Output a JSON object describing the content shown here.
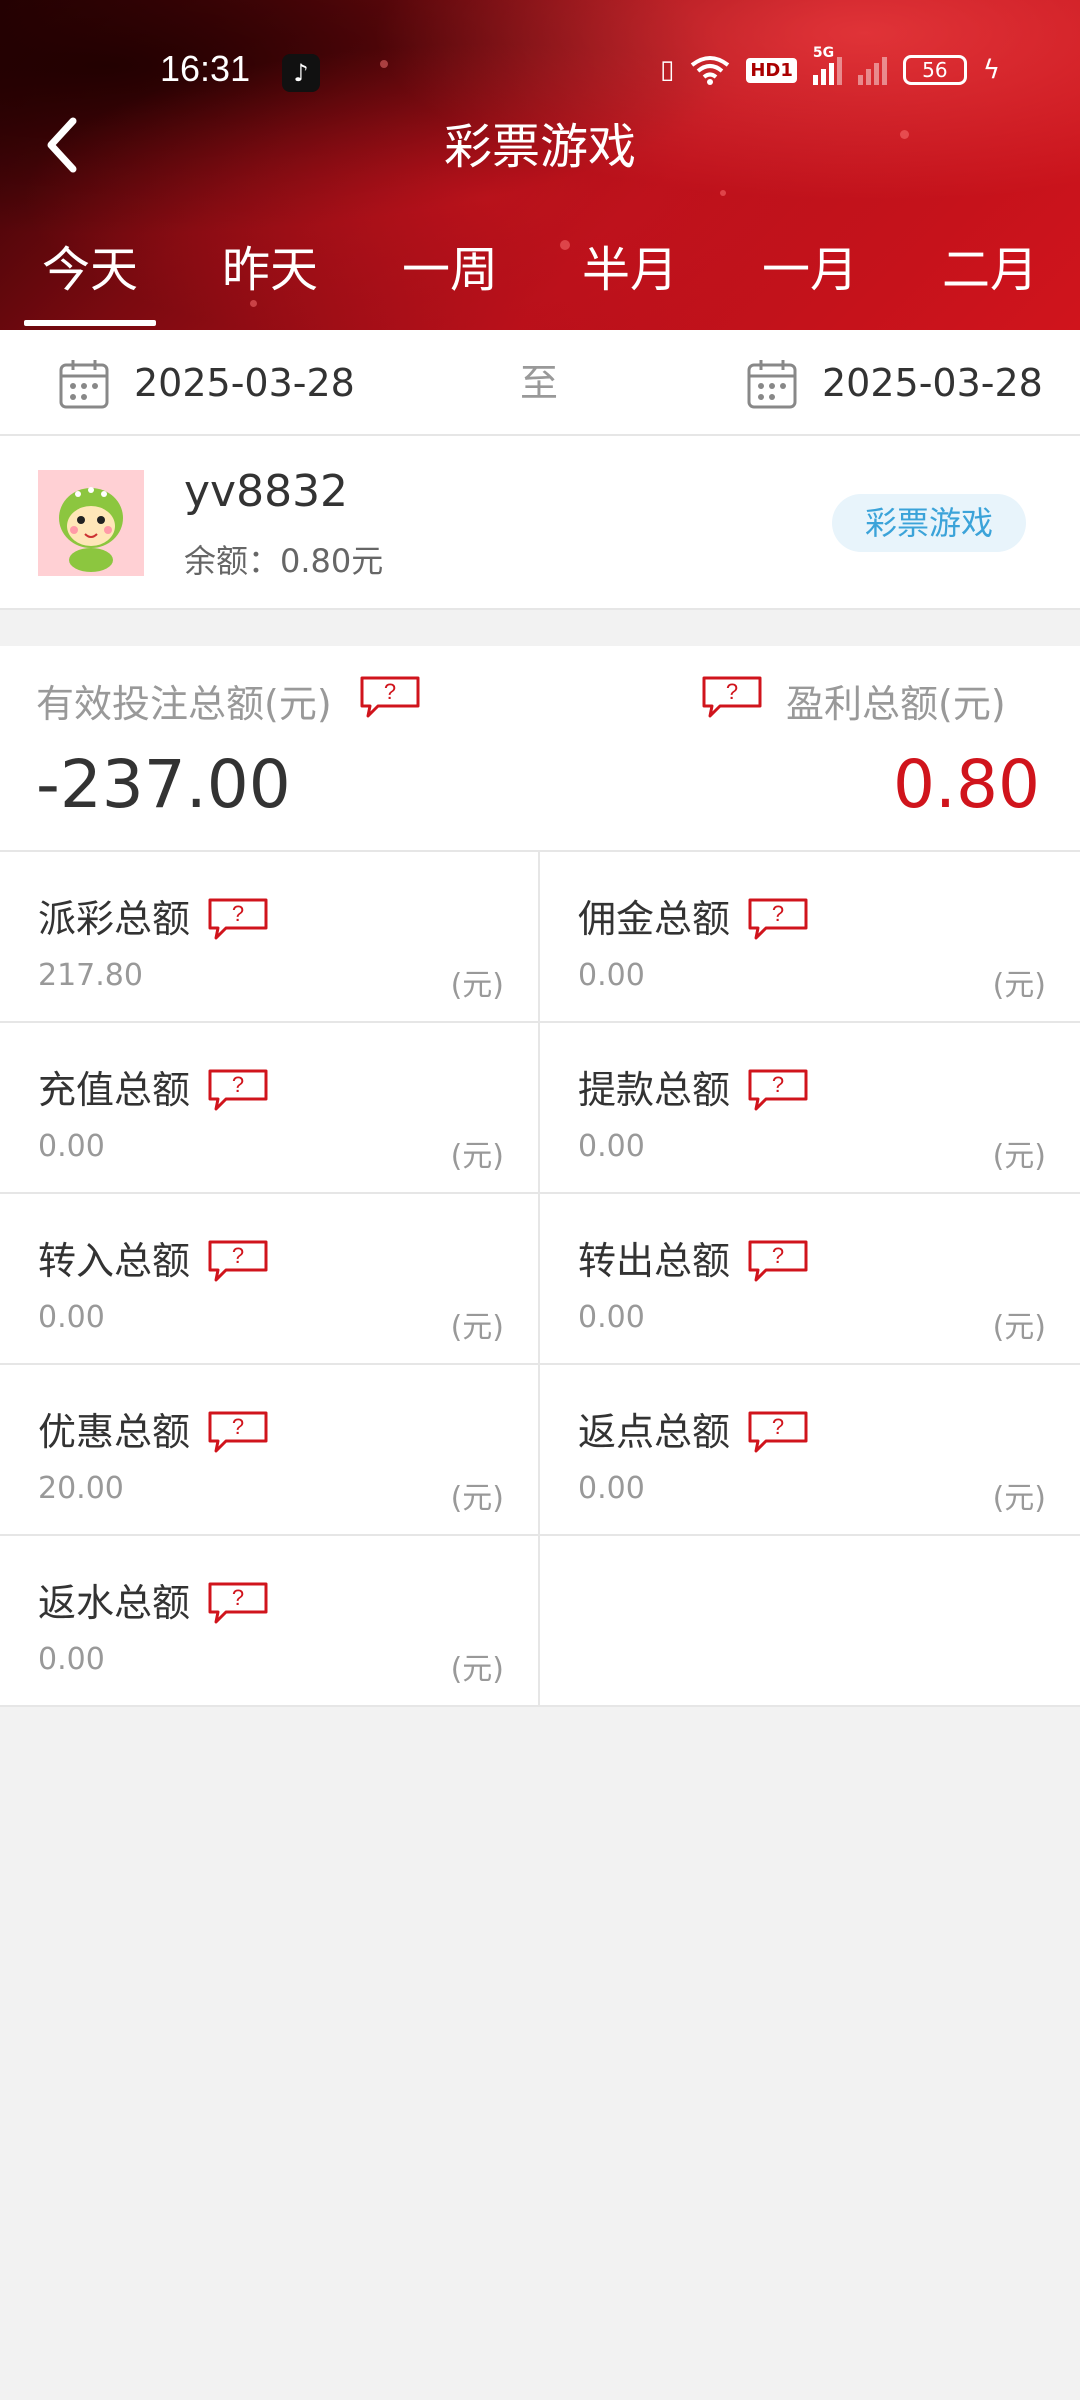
{
  "status_bar": {
    "time": "16:31",
    "app_icon": "tiktok-icon",
    "icons": [
      "vibrate-icon",
      "wifi-icon",
      "hd-icon",
      "signal-5g-icon",
      "signal-icon"
    ],
    "hd_label": "HD1",
    "network_label": "5G",
    "battery": "56"
  },
  "header": {
    "title": "彩票游戏",
    "back_icon": "chevron-left-icon"
  },
  "tabs": [
    {
      "label": "今天",
      "active": true
    },
    {
      "label": "昨天",
      "active": false
    },
    {
      "label": "一周",
      "active": false
    },
    {
      "label": "半月",
      "active": false
    },
    {
      "label": "一月",
      "active": false
    },
    {
      "label": "二月",
      "active": false
    }
  ],
  "date_range": {
    "start": "2025-03-28",
    "separator": "至",
    "end": "2025-03-28"
  },
  "user": {
    "name": "yv8832",
    "balance_label": "余额：",
    "balance_value": "0.80元",
    "category_tag": "彩票游戏"
  },
  "summary": {
    "bet_label": "有效投注总额(元)",
    "bet_value": "-237.00",
    "profit_label": "盈利总额(元)",
    "profit_value": "0.80"
  },
  "stats": [
    {
      "title": "派彩总额",
      "value": "217.80",
      "unit": "(元)"
    },
    {
      "title": "佣金总额",
      "value": "0.00",
      "unit": "(元)"
    },
    {
      "title": "充值总额",
      "value": "0.00",
      "unit": "(元)"
    },
    {
      "title": "提款总额",
      "value": "0.00",
      "unit": "(元)"
    },
    {
      "title": "转入总额",
      "value": "0.00",
      "unit": "(元)"
    },
    {
      "title": "转出总额",
      "value": "0.00",
      "unit": "(元)"
    },
    {
      "title": "优惠总额",
      "value": "20.00",
      "unit": "(元)"
    },
    {
      "title": "返点总额",
      "value": "0.00",
      "unit": "(元)"
    },
    {
      "title": "返水总额",
      "value": "0.00",
      "unit": "(元)"
    }
  ],
  "colors": {
    "accent_red": "#d0141c",
    "tag_blue": "#3ba3d9",
    "tag_bg": "#e8f4fb"
  }
}
